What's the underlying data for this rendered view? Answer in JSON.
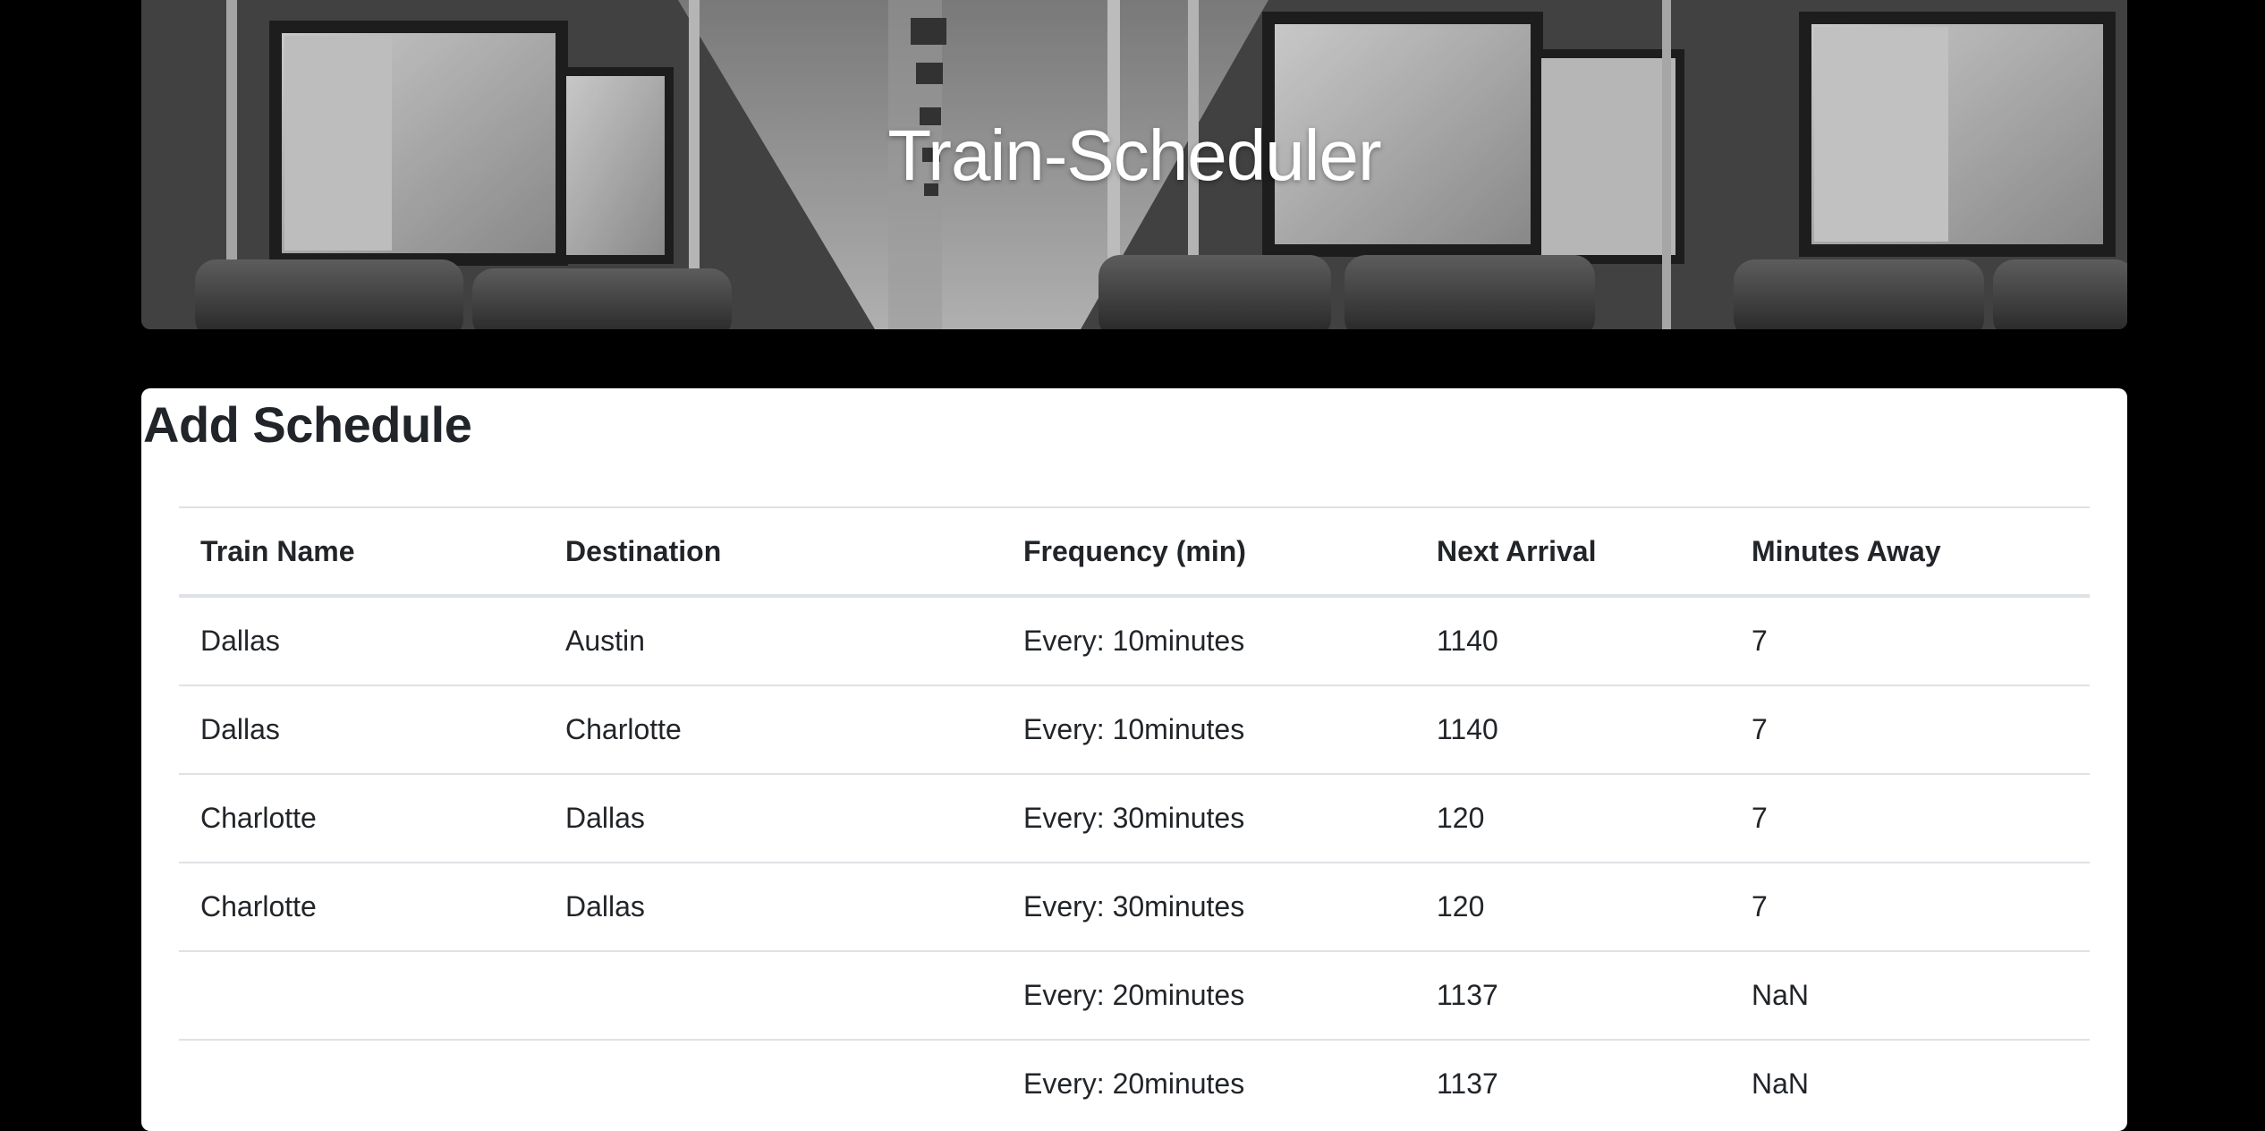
{
  "header": {
    "title": "Train-Scheduler"
  },
  "panel": {
    "heading": "Add Schedule"
  },
  "table": {
    "columns": [
      "Train Name",
      "Destination",
      "Frequency (min)",
      "Next Arrival",
      "Minutes Away"
    ],
    "rows": [
      [
        "Dallas",
        "Austin",
        "Every: 10minutes",
        "1140",
        "7"
      ],
      [
        "Dallas",
        "Charlotte",
        "Every: 10minutes",
        "1140",
        "7"
      ],
      [
        "Charlotte",
        "Dallas",
        "Every: 30minutes",
        "120",
        "7"
      ],
      [
        "Charlotte",
        "Dallas",
        "Every: 30minutes",
        "120",
        "7"
      ],
      [
        "",
        "",
        "Every: 20minutes",
        "1137",
        "NaN"
      ],
      [
        "",
        "",
        "Every: 20minutes",
        "1137",
        "NaN"
      ]
    ]
  },
  "colors": {
    "page_background": "#000000",
    "panel_background": "#ffffff",
    "text": "#212529",
    "table_border": "#dee2e6"
  }
}
